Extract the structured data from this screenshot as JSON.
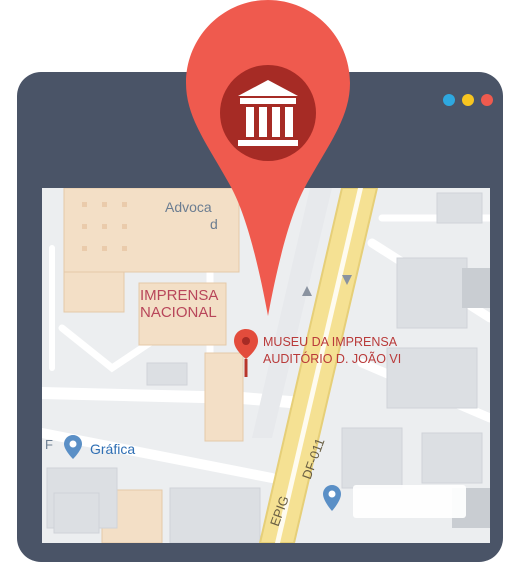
{
  "colors": {
    "frame": "#4a5467",
    "pin": "#ef5a4e",
    "pin_inner": "#a62b25",
    "map_bg": "#eceef0",
    "road_yellow": "#f5e193",
    "window_dots": [
      "#2ea8e0",
      "#f7c520",
      "#ef5a4e"
    ]
  },
  "icons": {
    "main_pin": "museum-icon",
    "location_pin": "map-pin-icon"
  },
  "map": {
    "labels": {
      "imprensa_line1": "IMPRENSA",
      "imprensa_line2": "NACIONAL",
      "museu_line1": "MUSEU DA IMPRENSA",
      "museu_line2": "AUDITÓRIO D. JOÃO VI",
      "advoca": "Advoca",
      "advoca_cont": "d",
      "grafica": "Gráfica",
      "f_fragment": "F"
    },
    "roads": {
      "epig": "EPIG",
      "df011": "DF-011"
    }
  }
}
